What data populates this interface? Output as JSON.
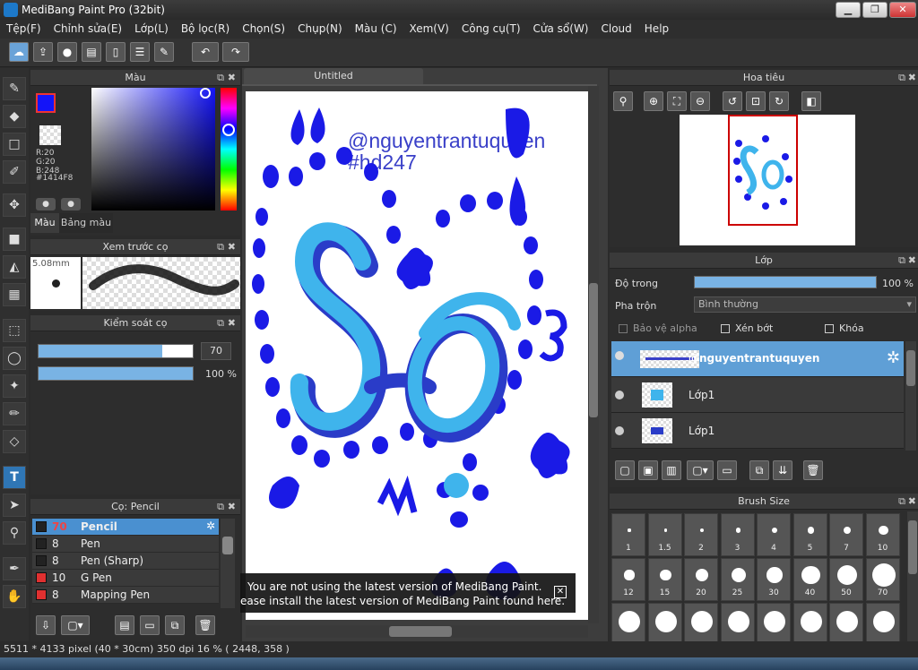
{
  "window": {
    "title": "MediBang Paint Pro (32bit)",
    "min": "▁",
    "max": "❐",
    "close": "✕"
  },
  "menu": [
    "Tệp(F)",
    "Chỉnh sửa(E)",
    "Lớp(L)",
    "Bộ lọc(R)",
    "Chọn(S)",
    "Chụp(N)",
    "Màu (C)",
    "Xem(V)",
    "Công cụ(T)",
    "Cửa sổ(W)",
    "Cloud",
    "Help"
  ],
  "color_panel": {
    "title": "Màu",
    "r": "R:20",
    "g": "G:20",
    "b": "B:248",
    "hex": "#1414F8",
    "tab_color": "Màu",
    "tab_palette": "Bảng màu",
    "main_color": "#1414F8"
  },
  "brush_preview": {
    "title": "Xem trước cọ",
    "size": "5.08mm"
  },
  "brush_control": {
    "title": "Kiểm soát cọ",
    "size_value": "70",
    "size_fraction": 0.8,
    "opacity_value": "100 %",
    "opacity_fraction": 1.0
  },
  "brush_list": {
    "title": "Cọ: Pencil",
    "items": [
      {
        "size": "70",
        "name": "Pencil",
        "color": "#222222",
        "selected": true
      },
      {
        "size": "8",
        "name": "Pen",
        "color": "#222222",
        "selected": false
      },
      {
        "size": "8",
        "name": "Pen (Sharp)",
        "color": "#222222",
        "selected": false
      },
      {
        "size": "10",
        "name": "G Pen",
        "color": "#e03030",
        "selected": false
      },
      {
        "size": "8",
        "name": "Mapping Pen",
        "color": "#e03030",
        "selected": false
      }
    ]
  },
  "canvas": {
    "tab": "Untitled",
    "watermark_line1": "@nguyentrantuquyen",
    "watermark_line2": "#hd247",
    "notice_line1": "You are not using the latest version of MediBang Paint.",
    "notice_line2": "ease install the latest version of MediBang Paint found here.",
    "notice_close": "✕"
  },
  "navigator": {
    "title": "Hoa tiêu"
  },
  "layers": {
    "title": "Lớp",
    "opacity_label": "Độ trong",
    "opacity_value": "100 %",
    "opacity_fraction": 1.0,
    "blend_label": "Pha trộn",
    "blend_value": "Bình thường",
    "protect_alpha": "Bảo vệ alpha",
    "clipping": "Xén bớt",
    "lock": "Khóa",
    "items": [
      {
        "name": "@nguyentrantuquyen",
        "selected": true
      },
      {
        "name": "Lớp1",
        "selected": false
      },
      {
        "name": "Lớp1",
        "selected": false
      }
    ]
  },
  "brush_size": {
    "title": "Brush Size",
    "row1": [
      "1",
      "1.5",
      "2",
      "3",
      "4",
      "5",
      "7",
      "10"
    ],
    "row2": [
      "12",
      "15",
      "20",
      "25",
      "30",
      "40",
      "50",
      "70"
    ]
  },
  "status": {
    "text": "5511 * 4133 pixel  (40 * 30cm)  350 dpi  16 %  ( 2448, 358 )"
  }
}
